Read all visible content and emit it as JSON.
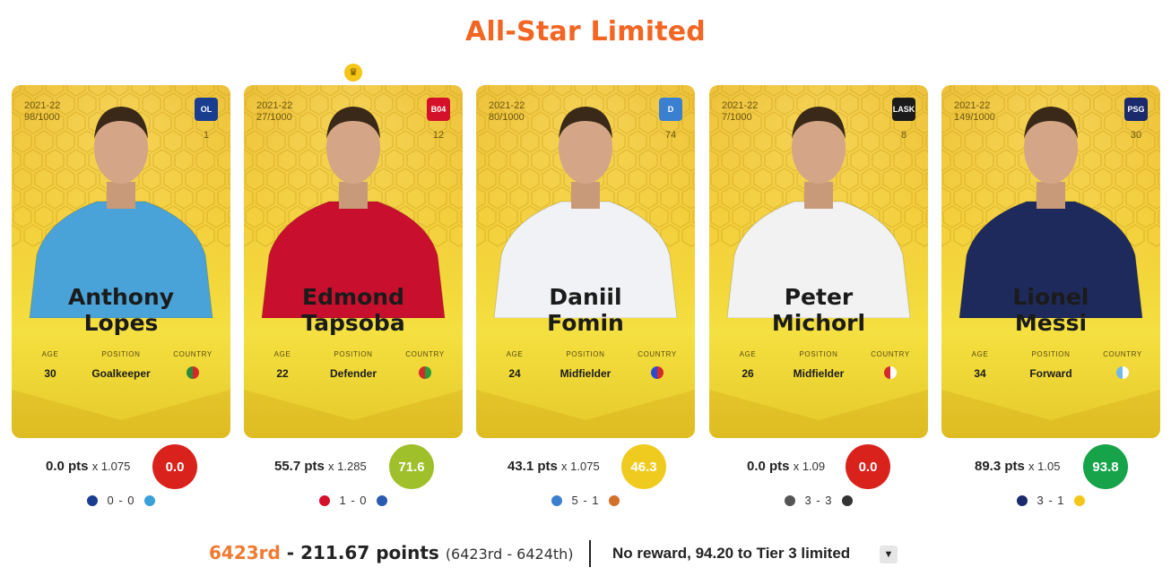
{
  "title": "All-Star Limited",
  "cards": [
    {
      "season": "2021-22",
      "serial": "98/1000",
      "club_abbr": "OL",
      "club_color": "#1a3e8f",
      "number": "1",
      "first": "Anthony",
      "last": "Lopes",
      "age": "30",
      "position": "Goalkeeper",
      "shirt": "#4aa3d8",
      "age_label": "AGE",
      "pos_label": "POSITION",
      "country_label": "COUNTRY",
      "flag": "#2a8a3a",
      "flag2": "#d42a2a"
    },
    {
      "season": "2021-22",
      "serial": "27/1000",
      "club_abbr": "B04",
      "club_color": "#d4102a",
      "number": "12",
      "first": "Edmond",
      "last": "Tapsoba",
      "age": "22",
      "position": "Defender",
      "shirt": "#c8102e",
      "age_label": "AGE",
      "pos_label": "POSITION",
      "country_label": "COUNTRY",
      "flag": "#d42a2a",
      "flag2": "#2a9a3a"
    },
    {
      "season": "2021-22",
      "serial": "80/1000",
      "club_abbr": "D",
      "club_color": "#3b7fd0",
      "number": "74",
      "first": "Daniil",
      "last": "Fomin",
      "age": "24",
      "position": "Midfielder",
      "shirt": "#f0f2f5",
      "age_label": "AGE",
      "pos_label": "POSITION",
      "country_label": "COUNTRY",
      "flag": "#2a4ad4",
      "flag2": "#d42a2a"
    },
    {
      "season": "2021-22",
      "serial": "7/1000",
      "club_abbr": "LASK",
      "club_color": "#1b1b1b",
      "number": "8",
      "first": "Peter",
      "last": "Michorl",
      "age": "26",
      "position": "Midfielder",
      "shirt": "#f2f2f2",
      "age_label": "AGE",
      "pos_label": "POSITION",
      "country_label": "COUNTRY",
      "flag": "#d42a2a",
      "flag2": "#ffffff"
    },
    {
      "season": "2021-22",
      "serial": "149/1000",
      "club_abbr": "PSG",
      "club_color": "#1a2a6c",
      "number": "30",
      "first": "Lionel",
      "last": "Messi",
      "age": "34",
      "position": "Forward",
      "shirt": "#1f2a5c",
      "age_label": "AGE",
      "pos_label": "POSITION",
      "country_label": "COUNTRY",
      "flag": "#74b8e8",
      "flag2": "#ffffff"
    }
  ],
  "scores": [
    {
      "pts": "0.0 pts",
      "mult": "x 1.075",
      "score": "0.0",
      "color": "#d9221c",
      "home_icon": "#1a3e8f",
      "result": "0 - 0",
      "away_icon": "#3aa0d8"
    },
    {
      "pts": "55.7 pts",
      "mult": "x 1.285",
      "score": "71.6",
      "color": "#9fc02a",
      "home_icon": "#d4102a",
      "result": "1 - 0",
      "away_icon": "#2a5ab0"
    },
    {
      "pts": "43.1 pts",
      "mult": "x 1.075",
      "score": "46.3",
      "color": "#efcb20",
      "home_icon": "#3b7fd0",
      "result": "5 - 1",
      "away_icon": "#d4702a"
    },
    {
      "pts": "0.0 pts",
      "mult": "x 1.09",
      "score": "0.0",
      "color": "#d9221c",
      "home_icon": "#555555",
      "result": "3 - 3",
      "away_icon": "#333333"
    },
    {
      "pts": "89.3 pts",
      "mult": "x 1.05",
      "score": "93.8",
      "color": "#16a34a",
      "home_icon": "#1a2a6c",
      "result": "3 - 1",
      "away_icon": "#f5c518"
    }
  ],
  "footer": {
    "rank": "6423rd",
    "sep": " - ",
    "points": "211.67 points",
    "range": "(6423rd - 6424th)",
    "reward": "No reward, 94.20 to Tier 3 limited"
  }
}
